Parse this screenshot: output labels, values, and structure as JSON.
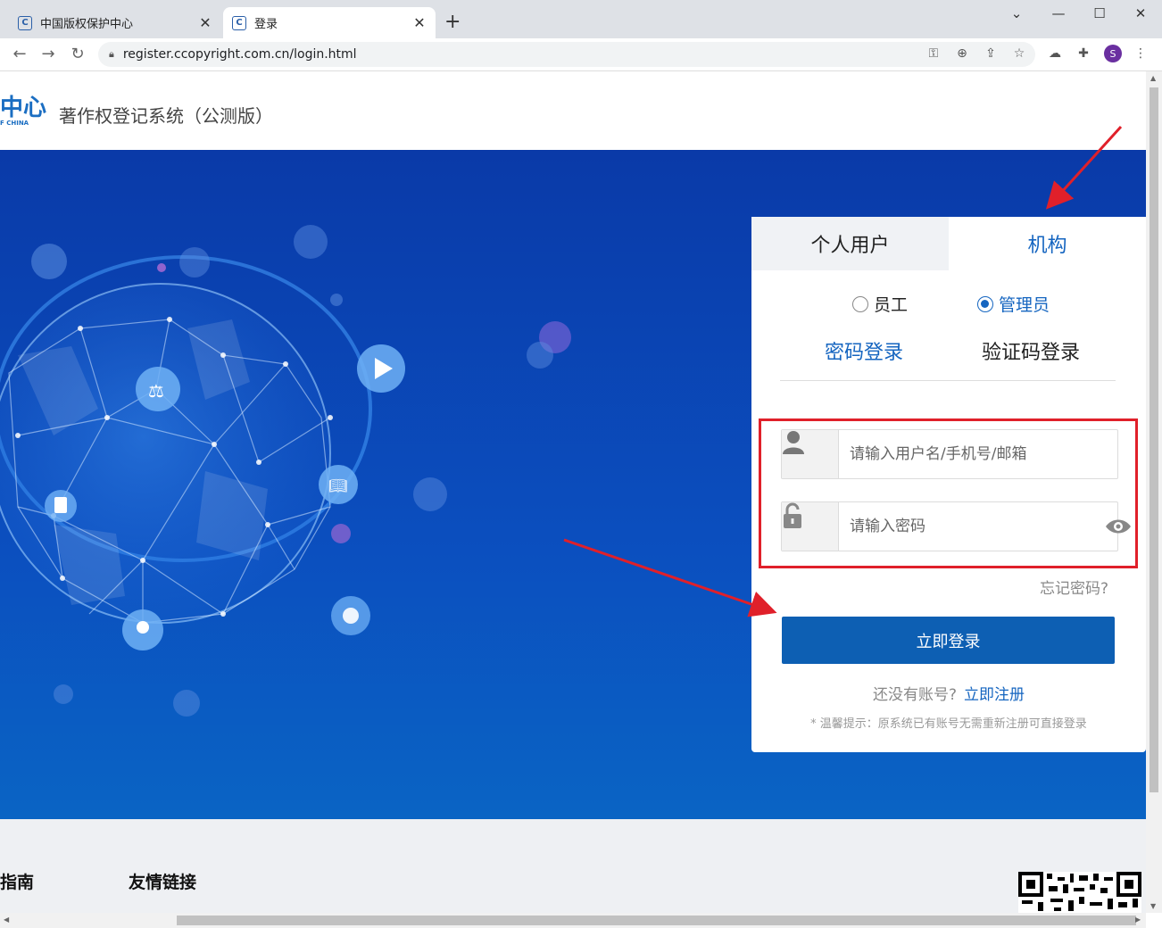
{
  "browser": {
    "tabs": [
      {
        "title": "中国版权保护中心",
        "favicon": "C",
        "active": false
      },
      {
        "title": "登录",
        "favicon": "C",
        "active": true
      }
    ],
    "url": "register.ccopyright.com.cn/login.html",
    "profile_initial": "S"
  },
  "header": {
    "logo_text": "中心",
    "logo_sub": "F CHINA",
    "site_title": "著作权登记系统（公测版）"
  },
  "login": {
    "tabs": {
      "personal": "个人用户",
      "org": "机构"
    },
    "roles": {
      "staff": "员工",
      "admin": "管理员",
      "selected": "admin"
    },
    "modes": {
      "password": "密码登录",
      "code": "验证码登录",
      "selected": "password"
    },
    "username_placeholder": "请输入用户名/手机号/邮箱",
    "password_placeholder": "请输入密码",
    "forgot": "忘记密码?",
    "submit": "立即登录",
    "no_account": "还没有账号?",
    "register": "立即注册",
    "tip": "* 温馨提示：原系统已有账号无需重新注册可直接登录"
  },
  "footer": {
    "col1": "指南",
    "col2": "友情链接"
  },
  "colors": {
    "accent": "#1565c0",
    "button": "#0d5fb3",
    "annotation": "#e0202a",
    "hero": "#0b4fbf"
  }
}
